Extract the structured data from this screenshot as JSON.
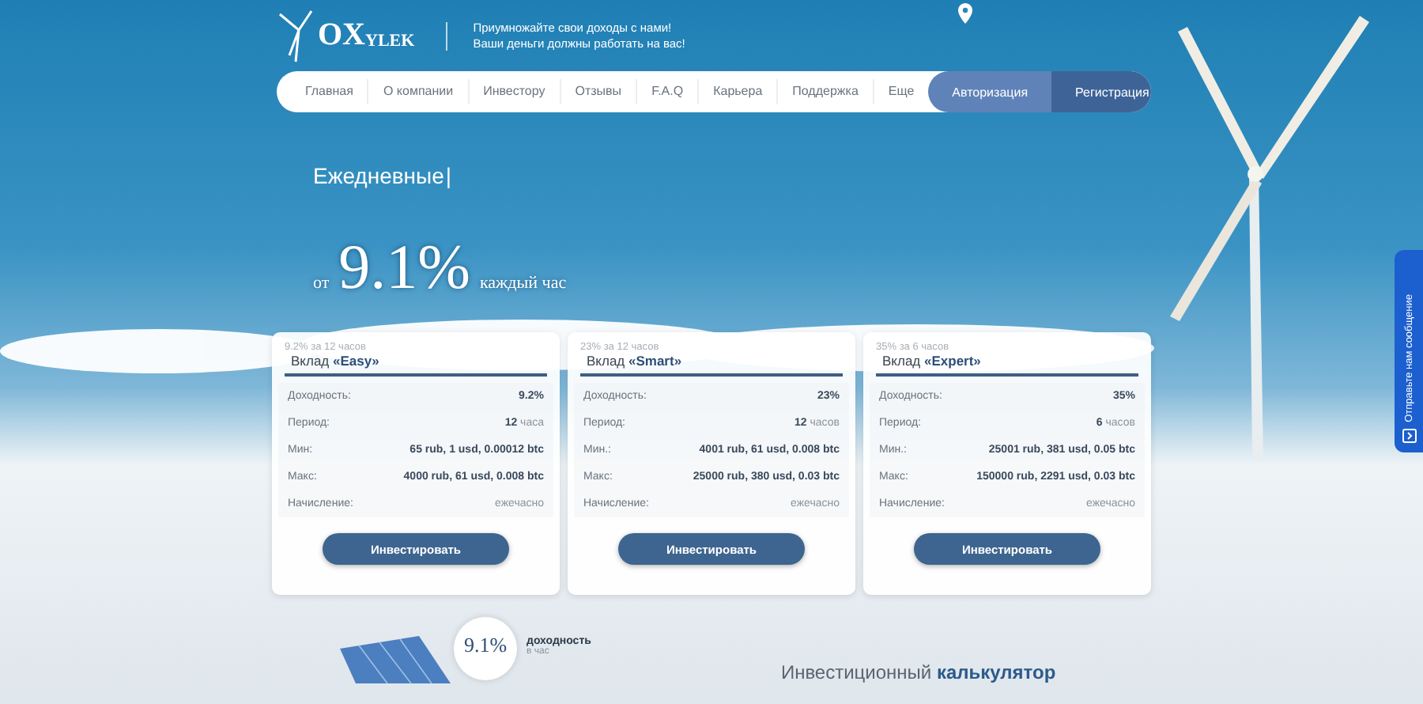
{
  "header": {
    "logo": "OX",
    "logo_small": "YLEK",
    "tagline": [
      "Приумножайте свои доходы с нами!",
      "Ваши деньги должны работать на вас!"
    ]
  },
  "nav": {
    "items": [
      "Главная",
      "О компании",
      "Инвестору",
      "Отзывы",
      "F.A.Q",
      "Карьера",
      "Поддержка",
      "Еще"
    ],
    "auth": [
      {
        "label": "Авторизация",
        "kind": "light"
      },
      {
        "label": "Регистрация",
        "kind": "dark"
      }
    ]
  },
  "hero": {
    "headline": "Ежедневные",
    "cursor": "|",
    "prefix": "от",
    "rate": "9.1%",
    "suffix": "каждый час"
  },
  "plans": [
    {
      "subtitle": "9.2% за 12 часов",
      "title": "Вклад **«Easy»**",
      "rows": [
        {
          "label": "Доходность:",
          "value": "**9.2%**"
        },
        {
          "label": "Период:",
          "value": "**12** часа"
        },
        {
          "label": "Мин:",
          "value": "**65 rub, 1 usd, 0.00012 btc**"
        },
        {
          "label": "Макс:",
          "value": "**4000 rub, 61 usd, 0.008 btc**"
        },
        {
          "label": "Начисление:",
          "value": "ежечасно"
        }
      ],
      "button": "Инвестировать"
    },
    {
      "subtitle": "23% за 12 часов",
      "title": "Вклад **«Smart»**",
      "rows": [
        {
          "label": "Доходность:",
          "value": "**23%**"
        },
        {
          "label": "Период:",
          "value": "**12** часов"
        },
        {
          "label": "Мин.:",
          "value": "**4001 rub, 61 usd, 0.008 btc**"
        },
        {
          "label": "Макс:",
          "value": "**25000 rub, 380 usd, 0.03 btc**"
        },
        {
          "label": "Начисление:",
          "value": "ежечасно"
        }
      ],
      "button": "Инвестировать"
    },
    {
      "subtitle": "35% за 6 часов",
      "title": "Вклад **«Expert»**",
      "rows": [
        {
          "label": "Доходность:",
          "value": "**35%**"
        },
        {
          "label": "Период:",
          "value": "**6** часов"
        },
        {
          "label": "Мин.:",
          "value": "**25001 rub, 381 usd, 0.05 btc**"
        },
        {
          "label": "Макс:",
          "value": "**150000 rub, 2291 usd, 0.03 btc**"
        },
        {
          "label": "Начисление:",
          "value": "ежечасно"
        }
      ],
      "button": "Инвестировать"
    }
  ],
  "bottom": {
    "badge": "9.1%",
    "badge_label": "доходность",
    "badge_sub": "в час",
    "calculator": "Инвестиционный **калькулятор**"
  },
  "side_tab": {
    "label": "Отправьте нам сообщение"
  }
}
